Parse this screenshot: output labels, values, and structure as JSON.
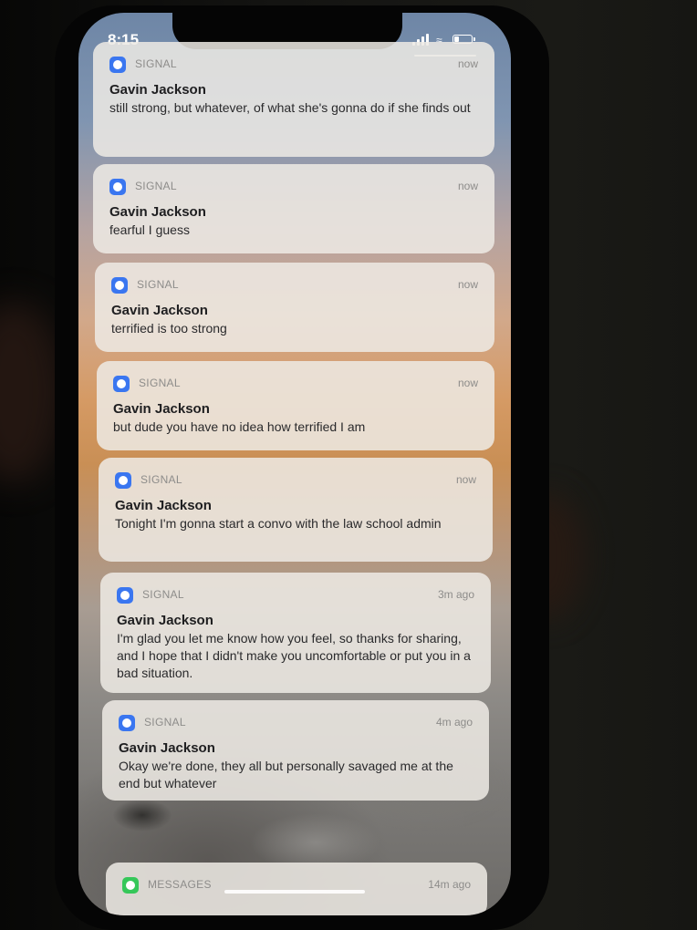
{
  "status_bar": {
    "time": "8:15",
    "battery_level": 0.3,
    "signal_bars": 4,
    "wifi_icon": "wifi-icon"
  },
  "notifications": [
    {
      "app": "SIGNAL",
      "time": "now",
      "sender": "Gavin Jackson",
      "message": "still strong, but whatever, of what she's gonna do if she finds out",
      "icon": "signal-app-icon"
    },
    {
      "app": "SIGNAL",
      "time": "now",
      "sender": "Gavin Jackson",
      "message": "fearful I guess",
      "icon": "signal-app-icon"
    },
    {
      "app": "SIGNAL",
      "time": "now",
      "sender": "Gavin Jackson",
      "message": "terrified is too strong",
      "icon": "signal-app-icon"
    },
    {
      "app": "SIGNAL",
      "time": "now",
      "sender": "Gavin Jackson",
      "message": "but dude you have no idea how terrified I am",
      "icon": "signal-app-icon"
    },
    {
      "app": "SIGNAL",
      "time": "now",
      "sender": "Gavin Jackson",
      "message": "Tonight I'm gonna start a convo with the law school admin",
      "icon": "signal-app-icon"
    },
    {
      "app": "SIGNAL",
      "time": "3m ago",
      "sender": "Gavin Jackson",
      "message": "I'm glad you let me know how you feel, so thanks for sharing, and I hope that I didn't make you uncomfortable or put you in a bad situation.",
      "icon": "signal-app-icon"
    },
    {
      "app": "SIGNAL",
      "time": "4m ago",
      "sender": "Gavin Jackson",
      "message": "Okay we're done, they all but personally savaged me at the end but whatever",
      "icon": "signal-app-icon"
    }
  ],
  "messages_notification": {
    "app": "MESSAGES",
    "time": "14m ago",
    "icon": "messages-app-icon"
  },
  "colors": {
    "signal_blue": "#3a76f0",
    "messages_green": "#35c759"
  }
}
